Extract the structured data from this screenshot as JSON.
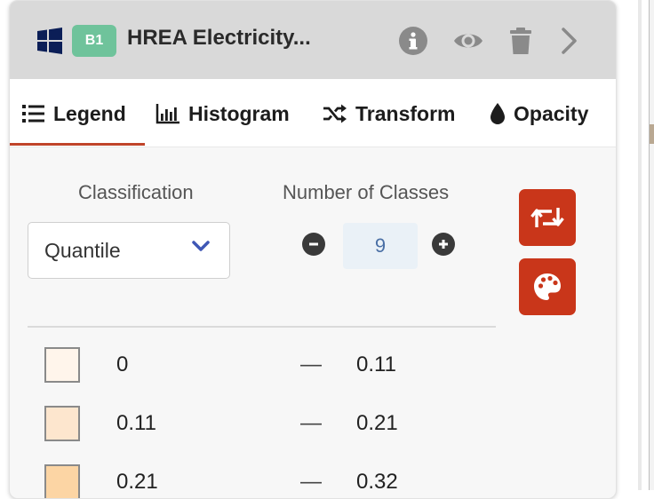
{
  "layer": {
    "badge": "B1",
    "title": "HREA Electricity..."
  },
  "header_icons": [
    "windows-icon",
    "info-icon",
    "eye-icon",
    "trash-icon",
    "chevron-right-icon"
  ],
  "tabs": [
    {
      "label": "Legend",
      "icon": "list-icon",
      "active": true
    },
    {
      "label": "Histogram",
      "icon": "histogram-icon",
      "active": false
    },
    {
      "label": "Transform",
      "icon": "shuffle-icon",
      "active": false
    },
    {
      "label": "Opacity",
      "icon": "droplet-icon",
      "active": false
    }
  ],
  "classification": {
    "label": "Classification",
    "value": "Quantile"
  },
  "classes": {
    "label": "Number of Classes",
    "value": "9"
  },
  "legend_rows": [
    {
      "min": "0",
      "dash": "—",
      "max": "0.11",
      "color": "#fff5eb"
    },
    {
      "min": "0.11",
      "dash": "—",
      "max": "0.21",
      "color": "#fde6ce"
    },
    {
      "min": "0.21",
      "dash": "—",
      "max": "0.32",
      "color": "#fcd5a4"
    }
  ],
  "colors": {
    "accent": "#c9361a",
    "badge": "#6fc39b",
    "tab_underline": "#c0442a"
  }
}
